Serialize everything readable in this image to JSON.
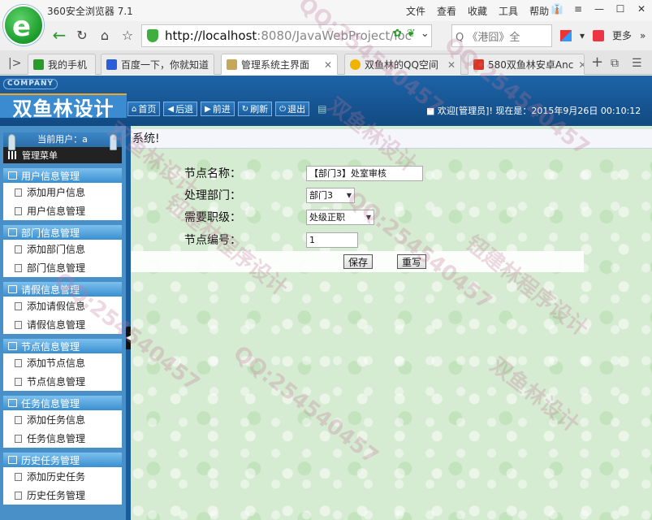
{
  "browser": {
    "title": "360安全浏览器 7.1",
    "menu": [
      "文件",
      "查看",
      "收藏",
      "工具",
      "帮助"
    ],
    "address_host": "http://localhost",
    "address_path": ":8080/JavaWebProject/loc",
    "search_text": "Q 《港囧》全",
    "more_label": "更多",
    "tabs": [
      {
        "label": "我的手机",
        "active": false
      },
      {
        "label": "百度一下，你就知道",
        "active": false
      },
      {
        "label": "管理系统主界面",
        "active": true
      },
      {
        "label": "双鱼林的QQ空间",
        "active": false
      },
      {
        "label": "580双鱼林安卓Anc",
        "active": false
      }
    ]
  },
  "app": {
    "company": "COMPANY",
    "logo_text": "双鱼林设计",
    "toolbar": [
      "首页",
      "后退",
      "前进",
      "刷新",
      "退出"
    ],
    "welcome": "欢迎[管理员]!   现在是：2015年9月26日  00:10:12"
  },
  "sidebar": {
    "current_user": "当前用户：a",
    "menu_title": "管理菜单",
    "groups": [
      {
        "title": "用户信息管理",
        "items": [
          "添加用户信息",
          "用户信息管理"
        ]
      },
      {
        "title": "部门信息管理",
        "items": [
          "添加部门信息",
          "部门信息管理"
        ]
      },
      {
        "title": "请假信息管理",
        "items": [
          "添加请假信息",
          "请假信息管理"
        ]
      },
      {
        "title": "节点信息管理",
        "items": [
          "添加节点信息",
          "节点信息管理"
        ]
      },
      {
        "title": "任务信息管理",
        "items": [
          "添加任务信息",
          "任务信息管理"
        ]
      },
      {
        "title": "历史任务管理",
        "items": [
          "添加历史任务",
          "历史任务管理"
        ]
      }
    ]
  },
  "main": {
    "section_title": "系统!",
    "form": {
      "node_name_label": "节点名称：",
      "node_name_value": "【部门3】处室审核",
      "dept_label": "处理部门：",
      "dept_value": "部门3",
      "rank_label": "需要职级：",
      "rank_value": "处级正职",
      "node_no_label": "节点编号：",
      "node_no_value": "1",
      "save_label": "保存",
      "reset_label": "重写"
    }
  },
  "watermark": {
    "texts": [
      "双鱼林设计",
      "QQ:254540457",
      "钮建林程序设计"
    ]
  },
  "colors": {
    "header_blue": "#1e64a8",
    "sidebar_blue": "#4a90c8",
    "content_green": "#d6ecd2"
  }
}
